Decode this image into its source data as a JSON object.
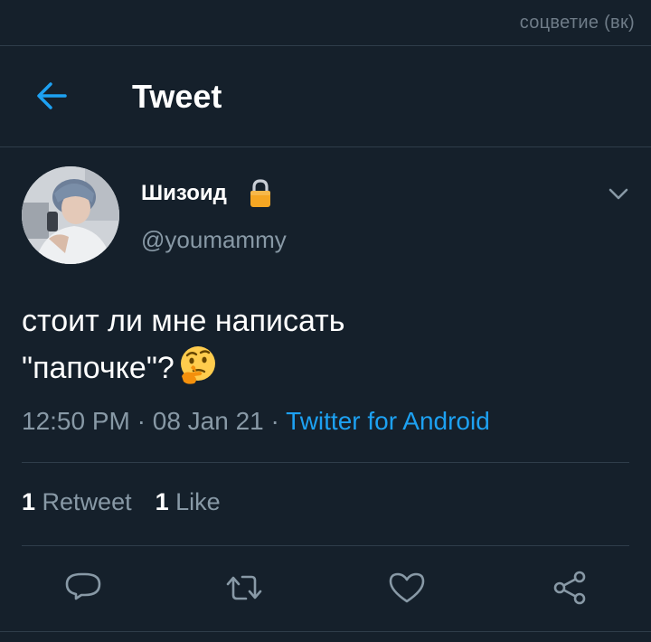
{
  "watermark": "соцветие (вк)",
  "header": {
    "title": "Tweet",
    "back_icon": "arrow-left-icon"
  },
  "author": {
    "display_name": "Шизоид",
    "handle": "@youmammy",
    "protected_icon": "lock-icon",
    "avatar_icon": "user-avatar"
  },
  "menu_icon": "chevron-down-icon",
  "tweet": {
    "line1": "стоит ли мне написать",
    "line2": "\"папочке\"?",
    "emoji": "thinking-face-emoji"
  },
  "meta": {
    "time": "12:50 PM",
    "dot1": " · ",
    "date": "08 Jan 21",
    "dot2": " · ",
    "client": "Twitter for Android"
  },
  "stats": {
    "retweets_count": "1",
    "retweets_label": "Retweet",
    "likes_count": "1",
    "likes_label": "Like"
  },
  "actions": [
    "reply-icon",
    "retweet-icon",
    "like-icon",
    "share-icon"
  ],
  "colors": {
    "background": "#15202b",
    "separator": "#2f3d4a",
    "accent": "#1da1f2",
    "secondary_text": "#8899a6",
    "primary_text": "#ffffff"
  }
}
